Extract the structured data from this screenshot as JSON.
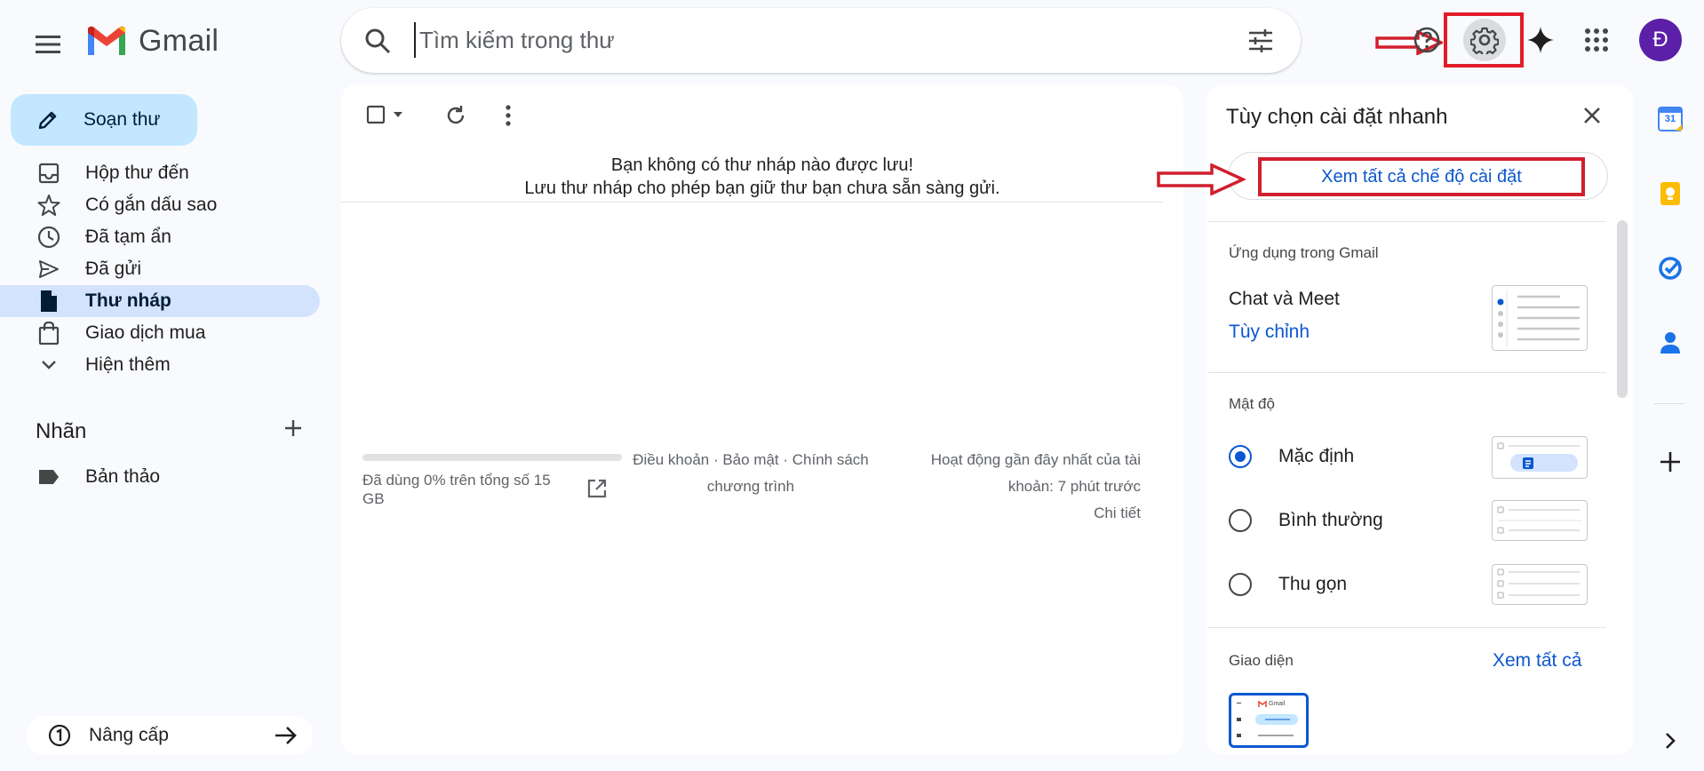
{
  "app": {
    "name": "Gmail"
  },
  "search": {
    "placeholder": "Tìm kiếm trong thư"
  },
  "header": {
    "avatar_initial": "Đ"
  },
  "compose": {
    "label": "Soạn thư"
  },
  "nav": {
    "items": [
      {
        "label": "Hộp thư đến",
        "icon": "inbox-icon"
      },
      {
        "label": "Có gắn dấu sao",
        "icon": "star-icon"
      },
      {
        "label": "Đã tạm ẩn",
        "icon": "clock-icon"
      },
      {
        "label": "Đã gửi",
        "icon": "send-icon"
      },
      {
        "label": "Thư nháp",
        "icon": "draft-icon",
        "active": true
      },
      {
        "label": "Giao dịch mua",
        "icon": "shopping-bag-icon"
      },
      {
        "label": "Hiện thêm",
        "icon": "chevron-down-icon"
      }
    ],
    "labels_heading": "Nhãn",
    "labels": [
      {
        "label": "Bản thảo"
      }
    ],
    "upgrade_label": "Nâng cấp"
  },
  "main": {
    "empty_line1": "Bạn không có thư nháp nào được lưu!",
    "empty_line2": "Lưu thư nháp cho phép bạn giữ thư bạn chưa sẵn sàng gửi.",
    "storage_text": "Đã dùng 0% trên tổng số 15 GB",
    "storage_percent": 0,
    "footer_links_line1": "Điều khoản · Bảo mật · Chính sách",
    "footer_links_line2": "chương trình",
    "activity_line1": "Hoạt động gần đây nhất của tài",
    "activity_line2": "khoản: 7 phút trước",
    "activity_details": "Chi tiết"
  },
  "quick_settings": {
    "title": "Tùy chọn cài đặt nhanh",
    "see_all": "Xem tất cả chế độ cài đặt",
    "apps_section": "Ứng dụng trong Gmail",
    "chat_label": "Chat và Meet",
    "customize": "Tùy chỉnh",
    "density_section": "Mật độ",
    "density_options": [
      {
        "label": "Mặc định",
        "selected": true
      },
      {
        "label": "Bình thường",
        "selected": false
      },
      {
        "label": "Thu gọn",
        "selected": false
      }
    ],
    "theme_section": "Giao diện",
    "theme_see_all": "Xem tất cả",
    "theme_thumb_brand": "Gmail"
  },
  "rail": {
    "calendar_day": "31"
  },
  "colors": {
    "accent": "#0b57d0",
    "compose_bg": "#c2e7ff",
    "active_nav": "#d3e3fd",
    "annotation_red": "#d01f2e",
    "avatar": "#5b1fa8"
  }
}
